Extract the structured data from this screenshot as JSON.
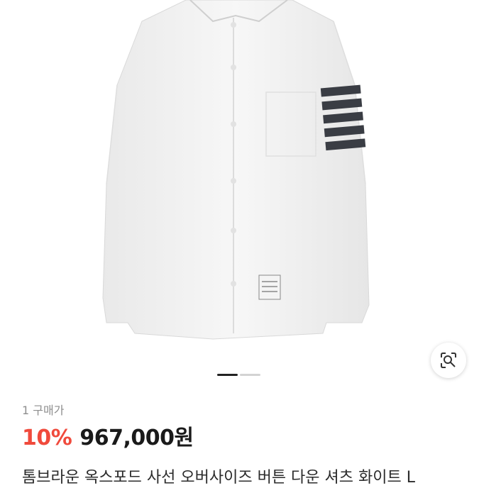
{
  "gallery": {
    "image_description_icon": "shirt-photo",
    "lens_icon": "image-search-icon",
    "pages_total": 2,
    "page_current": 1
  },
  "product": {
    "purchase_count": "1 구매가",
    "discount": "10%",
    "price": "967,000원",
    "title": "톰브라운 옥스포드 사선 오버사이즈 버튼 다운 셔츠 화이트 L"
  },
  "colors": {
    "discount": "#f04a3c",
    "price": "#1a1a1a",
    "muted": "#8e8e8e",
    "pager_active": "#222222",
    "pager_inactive": "#d3d3d3"
  }
}
